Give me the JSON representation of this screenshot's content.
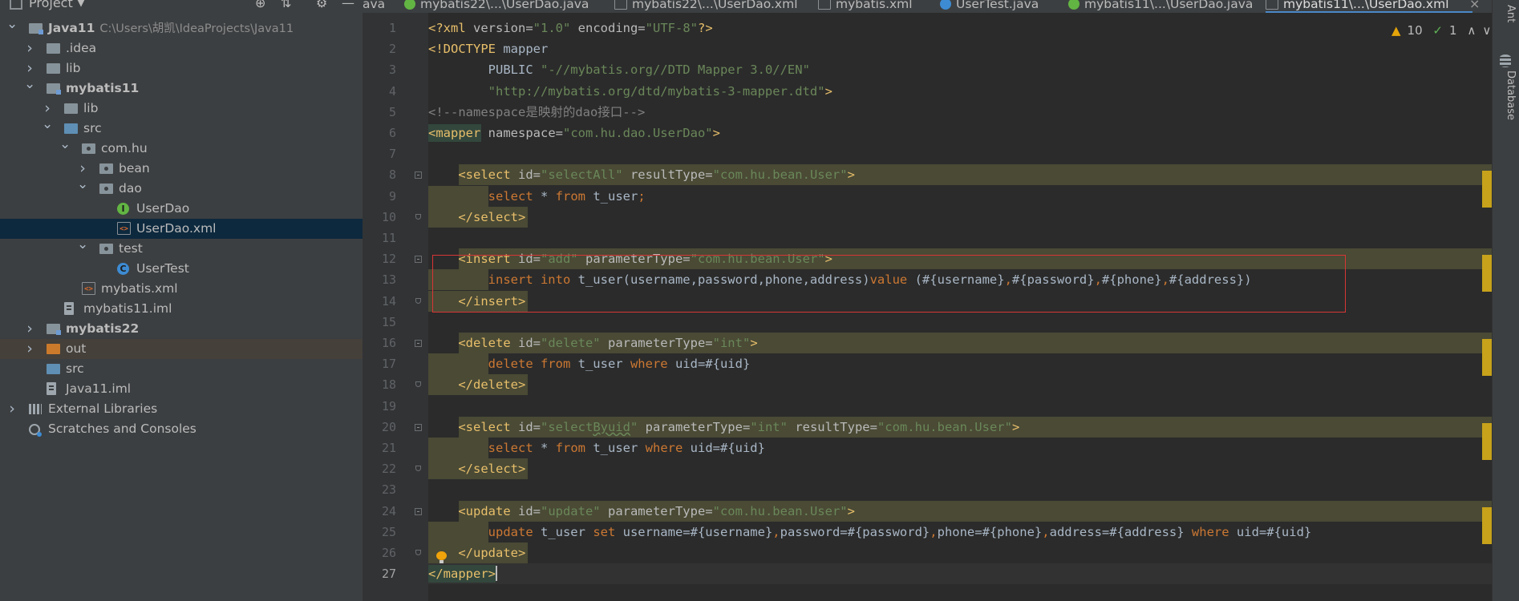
{
  "project_panel": {
    "title": "Project",
    "tree": [
      {
        "label": "Java11",
        "path": "C:\\Users\\胡凯\\IdeaProjects\\Java11",
        "depth": 0,
        "chevron": "down",
        "icon": "module-folder",
        "bold": true
      },
      {
        "label": ".idea",
        "depth": 1,
        "chevron": "right",
        "icon": "folder"
      },
      {
        "label": "lib",
        "depth": 1,
        "chevron": "right",
        "icon": "folder"
      },
      {
        "label": "mybatis11",
        "depth": 1,
        "chevron": "down",
        "icon": "module-folder",
        "bold": true
      },
      {
        "label": "lib",
        "depth": 2,
        "chevron": "right",
        "icon": "folder"
      },
      {
        "label": "src",
        "depth": 2,
        "chevron": "down",
        "icon": "source-folder"
      },
      {
        "label": "com.hu",
        "depth": 3,
        "chevron": "down",
        "icon": "package"
      },
      {
        "label": "bean",
        "depth": 4,
        "chevron": "right",
        "icon": "package"
      },
      {
        "label": "dao",
        "depth": 4,
        "chevron": "down",
        "icon": "package"
      },
      {
        "label": "UserDao",
        "depth": 5,
        "icon": "interface"
      },
      {
        "label": "UserDao.xml",
        "depth": 5,
        "icon": "xml-file",
        "selected": true
      },
      {
        "label": "test",
        "depth": 4,
        "chevron": "down",
        "icon": "package"
      },
      {
        "label": "UserTest",
        "depth": 5,
        "icon": "class"
      },
      {
        "label": "mybatis.xml",
        "depth": 3,
        "icon": "xml-file"
      },
      {
        "label": "mybatis11.iml",
        "depth": 2,
        "icon": "iml-file"
      },
      {
        "label": "mybatis22",
        "depth": 1,
        "chevron": "right",
        "icon": "module-folder",
        "bold": true
      },
      {
        "label": "out",
        "depth": 1,
        "chevron": "right",
        "icon": "excluded-folder",
        "excluded": true
      },
      {
        "label": "src",
        "depth": 1,
        "icon": "source-folder"
      },
      {
        "label": "Java11.iml",
        "depth": 1,
        "icon": "iml-file"
      },
      {
        "label": "External Libraries",
        "depth": 0,
        "chevron": "right",
        "icon": "library"
      },
      {
        "label": "Scratches and Consoles",
        "depth": 0,
        "icon": "scratches"
      }
    ]
  },
  "tabs": [
    {
      "label": "ava",
      "icon": "none"
    },
    {
      "label": "mybatis22\\...\\UserDao.java",
      "icon": "interface"
    },
    {
      "label": "mybatis22\\...\\UserDao.xml",
      "icon": "xml"
    },
    {
      "label": "mybatis.xml",
      "icon": "xml"
    },
    {
      "label": "UserTest.java",
      "icon": "class"
    },
    {
      "label": "mybatis11\\...\\UserDao.java",
      "icon": "interface"
    },
    {
      "label": "mybatis11\\...\\UserDao.xml",
      "icon": "xml",
      "active": true
    }
  ],
  "inspection": {
    "warnings": "10",
    "ok": "1"
  },
  "right_tools": [
    "Ant",
    "Database"
  ],
  "editor": {
    "current_line": 27,
    "lines": [
      {
        "n": 1,
        "tokens": [
          [
            "t-tag",
            "<?xml "
          ],
          [
            "t-attr",
            "version="
          ],
          [
            "t-val",
            "\"1.0\" "
          ],
          [
            "t-attr",
            "encoding="
          ],
          [
            "t-val",
            "\"UTF-8\""
          ],
          [
            "t-tag",
            "?>"
          ]
        ]
      },
      {
        "n": 2,
        "tokens": [
          [
            "t-tag",
            "<!DOCTYPE "
          ],
          [
            "t-plain",
            "mapper"
          ]
        ]
      },
      {
        "n": 3,
        "tokens": [
          [
            "t-plain",
            "        PUBLIC "
          ],
          [
            "t-val",
            "\"-//mybatis.org//DTD Mapper 3.0//EN\""
          ]
        ]
      },
      {
        "n": 4,
        "tokens": [
          [
            "t-val",
            "        \"http://mybatis.org/dtd/mybatis-3-mapper.dtd\""
          ],
          [
            "t-tag",
            ">"
          ]
        ]
      },
      {
        "n": 5,
        "tokens": [
          [
            "t-cmt",
            "<!--namespace是映射的dao接口-->"
          ]
        ]
      },
      {
        "n": 6,
        "tokens": [
          [
            "t-mapper",
            "<mapper"
          ],
          [
            "t-attr",
            " namespace="
          ],
          [
            "t-val",
            "\"com.hu.dao.UserDao\""
          ],
          [
            "t-tag",
            ">"
          ]
        ]
      },
      {
        "n": 7,
        "tokens": []
      },
      {
        "n": 8,
        "tokens": [
          [
            "t-plain",
            "    "
          ],
          [
            "t-tag",
            "<select "
          ],
          [
            "t-attr",
            "id="
          ],
          [
            "t-val",
            "\"selectAll\" "
          ],
          [
            "t-attr",
            "resultType="
          ],
          [
            "t-val",
            "\"com.hu.bean.User\""
          ],
          [
            "t-tag",
            ">"
          ]
        ]
      },
      {
        "n": 9,
        "tokens": [
          [
            "t-plain",
            "        "
          ],
          [
            "t-kw",
            "select "
          ],
          [
            "t-plain",
            "* "
          ],
          [
            "t-kw",
            "from "
          ],
          [
            "t-plain",
            "t_user"
          ],
          [
            "t-kw",
            ";"
          ]
        ]
      },
      {
        "n": 10,
        "tokens": [
          [
            "t-plain",
            "    "
          ],
          [
            "t-tag",
            "</select>"
          ]
        ]
      },
      {
        "n": 11,
        "tokens": []
      },
      {
        "n": 12,
        "tokens": [
          [
            "t-plain",
            "    "
          ],
          [
            "t-tag",
            "<insert "
          ],
          [
            "t-attr",
            "id="
          ],
          [
            "t-val",
            "\"add\" "
          ],
          [
            "t-attr",
            "parameterType="
          ],
          [
            "t-val",
            "\"com.hu.bean.User\""
          ],
          [
            "t-tag",
            ">"
          ]
        ]
      },
      {
        "n": 13,
        "tokens": [
          [
            "t-plain",
            "        "
          ],
          [
            "t-kw",
            "insert into "
          ],
          [
            "t-plain",
            "t_user(username,password,phone,address)"
          ],
          [
            "t-kw",
            "value "
          ],
          [
            "t-plain",
            "(#{username}"
          ],
          [
            "t-kw",
            ","
          ],
          [
            "t-plain",
            "#{password}"
          ],
          [
            "t-kw",
            ","
          ],
          [
            "t-plain",
            "#{phone}"
          ],
          [
            "t-kw",
            ","
          ],
          [
            "t-plain",
            "#{address})"
          ]
        ]
      },
      {
        "n": 14,
        "tokens": [
          [
            "t-plain",
            "    "
          ],
          [
            "t-tag",
            "</insert>"
          ]
        ]
      },
      {
        "n": 15,
        "tokens": []
      },
      {
        "n": 16,
        "tokens": [
          [
            "t-plain",
            "    "
          ],
          [
            "t-tag",
            "<delete "
          ],
          [
            "t-attr",
            "id="
          ],
          [
            "t-val",
            "\"delete\" "
          ],
          [
            "t-attr",
            "parameterType="
          ],
          [
            "t-val",
            "\"int\""
          ],
          [
            "t-tag",
            ">"
          ]
        ]
      },
      {
        "n": 17,
        "tokens": [
          [
            "t-plain",
            "        "
          ],
          [
            "t-kw",
            "delete from "
          ],
          [
            "t-plain",
            "t_user "
          ],
          [
            "t-kw",
            "where "
          ],
          [
            "t-plain",
            "uid=#{uid}"
          ]
        ]
      },
      {
        "n": 18,
        "tokens": [
          [
            "t-plain",
            "    "
          ],
          [
            "t-tag",
            "</delete>"
          ]
        ]
      },
      {
        "n": 19,
        "tokens": []
      },
      {
        "n": 20,
        "tokens": [
          [
            "t-plain",
            "    "
          ],
          [
            "t-tag",
            "<select "
          ],
          [
            "t-attr",
            "id="
          ],
          [
            "t-val",
            "\"select"
          ],
          [
            "t-val squiggle",
            "Byuid"
          ],
          [
            "t-val",
            "\" "
          ],
          [
            "t-attr",
            "parameterType="
          ],
          [
            "t-val",
            "\"int\" "
          ],
          [
            "t-attr",
            "resultType="
          ],
          [
            "t-val",
            "\"com.hu.bean.User\""
          ],
          [
            "t-tag",
            ">"
          ]
        ]
      },
      {
        "n": 21,
        "tokens": [
          [
            "t-plain",
            "        "
          ],
          [
            "t-kw",
            "select "
          ],
          [
            "t-plain",
            "* "
          ],
          [
            "t-kw",
            "from "
          ],
          [
            "t-plain",
            "t_user "
          ],
          [
            "t-kw",
            "where "
          ],
          [
            "t-plain",
            "uid=#{uid}"
          ]
        ]
      },
      {
        "n": 22,
        "tokens": [
          [
            "t-plain",
            "    "
          ],
          [
            "t-tag",
            "</select>"
          ]
        ]
      },
      {
        "n": 23,
        "tokens": []
      },
      {
        "n": 24,
        "tokens": [
          [
            "t-plain",
            "    "
          ],
          [
            "t-tag",
            "<update "
          ],
          [
            "t-attr",
            "id="
          ],
          [
            "t-val",
            "\"update\" "
          ],
          [
            "t-attr",
            "parameterType="
          ],
          [
            "t-val",
            "\"com.hu.bean.User\""
          ],
          [
            "t-tag",
            ">"
          ]
        ]
      },
      {
        "n": 25,
        "tokens": [
          [
            "t-plain",
            "        "
          ],
          [
            "t-kw",
            "update "
          ],
          [
            "t-plain",
            "t_user "
          ],
          [
            "t-kw",
            "set "
          ],
          [
            "t-plain",
            "username=#{username}"
          ],
          [
            "t-kw",
            ","
          ],
          [
            "t-plain",
            "password=#{password}"
          ],
          [
            "t-kw",
            ","
          ],
          [
            "t-plain",
            "phone=#{phone}"
          ],
          [
            "t-kw",
            ","
          ],
          [
            "t-plain",
            "address=#{address} "
          ],
          [
            "t-kw",
            "where "
          ],
          [
            "t-plain",
            "uid=#{uid}"
          ]
        ]
      },
      {
        "n": 26,
        "tokens": [
          [
            "t-plain",
            "    "
          ],
          [
            "t-tag",
            "</update>"
          ]
        ]
      },
      {
        "n": 27,
        "tokens": [
          [
            "t-mapper",
            "</mapper>"
          ]
        ]
      }
    ]
  }
}
